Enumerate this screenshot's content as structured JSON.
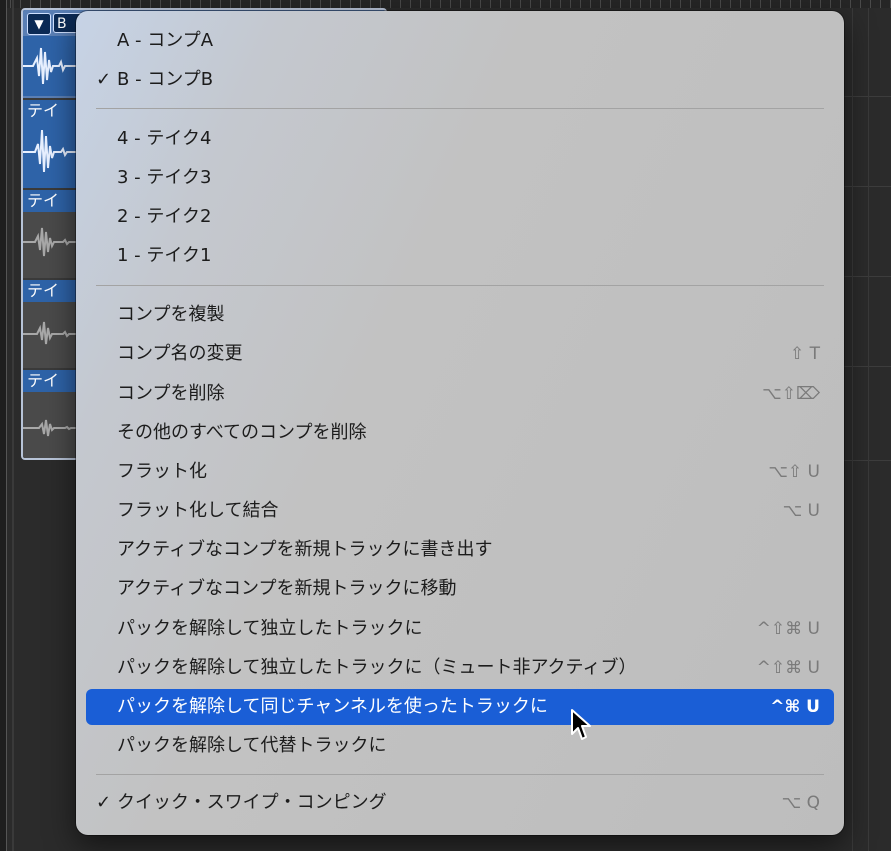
{
  "take_folder": {
    "toggle_glyph": "▼",
    "comp_label": "B",
    "takes": [
      {
        "label": "テイ"
      },
      {
        "label": "テイ"
      },
      {
        "label": "テイ"
      },
      {
        "label": "テイ"
      }
    ]
  },
  "menu": {
    "comps": [
      {
        "label": "A - コンプA",
        "checked": false,
        "check": ""
      },
      {
        "label": "B - コンプB",
        "checked": true,
        "check": "✓"
      }
    ],
    "takes": [
      {
        "label": "4 - テイク4"
      },
      {
        "label": "3 - テイク3"
      },
      {
        "label": "2 - テイク2"
      },
      {
        "label": "1 - テイク1"
      }
    ],
    "actions": [
      {
        "label": "コンプを複製",
        "shortcut": ""
      },
      {
        "label": "コンプ名の変更",
        "shortcut": "⇧ T"
      },
      {
        "label": "コンプを削除",
        "shortcut": "⌥⇧⌦"
      },
      {
        "label": "その他のすべてのコンプを削除",
        "shortcut": ""
      },
      {
        "label": "フラット化",
        "shortcut": "⌥⇧ U"
      },
      {
        "label": "フラット化して結合",
        "shortcut": "⌥ U"
      },
      {
        "label": "アクティブなコンプを新規トラックに書き出す",
        "shortcut": ""
      },
      {
        "label": "アクティブなコンプを新規トラックに移動",
        "shortcut": ""
      },
      {
        "label": "パックを解除して独立したトラックに",
        "shortcut": "^⇧⌘ U"
      },
      {
        "label": "パックを解除して独立したトラックに（ミュート非アクティブ）",
        "shortcut": "^⇧⌘ U"
      },
      {
        "label": "パックを解除して同じチャンネルを使ったトラックに",
        "shortcut": "^⌘ U",
        "highlighted": true
      },
      {
        "label": "パックを解除して代替トラックに",
        "shortcut": ""
      }
    ],
    "quick_swipe": {
      "label": "クイック・スワイプ・コンピング",
      "checked": true,
      "check": "✓",
      "shortcut": "⌥ Q"
    }
  },
  "colors": {
    "highlight": "#1a5ed6",
    "menu_bg": "#c2c2c2",
    "take_blue": "#2e63a8"
  }
}
